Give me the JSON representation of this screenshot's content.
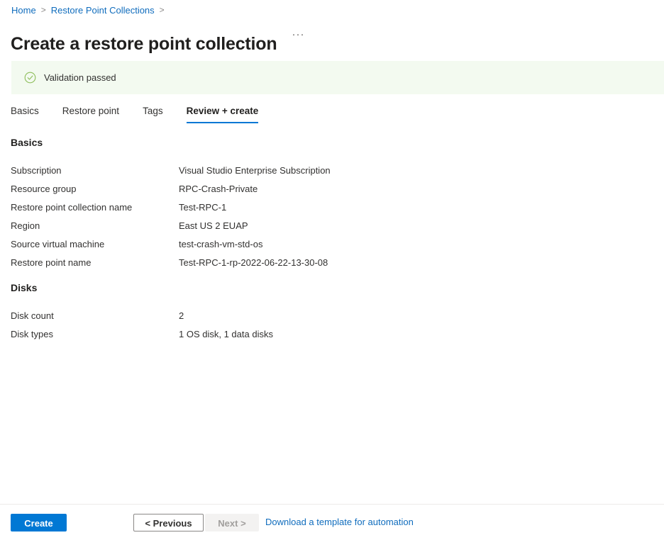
{
  "breadcrumb": {
    "items": [
      {
        "label": "Home"
      },
      {
        "label": "Restore Point Collections"
      }
    ],
    "separator": ">"
  },
  "header": {
    "title": "Create a restore point collection",
    "more_actions": "···"
  },
  "validation": {
    "message": "Validation passed",
    "icon": "check-circle-icon",
    "background_color": "#f3faf0",
    "icon_color": "#8cbd59"
  },
  "tabs": [
    {
      "label": "Basics",
      "active": false
    },
    {
      "label": "Restore point",
      "active": false
    },
    {
      "label": "Tags",
      "active": false
    },
    {
      "label": "Review + create",
      "active": true
    }
  ],
  "sections": [
    {
      "heading": "Basics",
      "rows": [
        {
          "label": "Subscription",
          "value": "Visual Studio Enterprise Subscription"
        },
        {
          "label": "Resource group",
          "value": "RPC-Crash-Private"
        },
        {
          "label": "Restore point collection name",
          "value": "Test-RPC-1"
        },
        {
          "label": "Region",
          "value": "East US 2 EUAP"
        },
        {
          "label": "Source virtual machine",
          "value": "test-crash-vm-std-os"
        },
        {
          "label": "Restore point name",
          "value": "Test-RPC-1-rp-2022-06-22-13-30-08"
        }
      ]
    },
    {
      "heading": "Disks",
      "rows": [
        {
          "label": "Disk count",
          "value": "2"
        },
        {
          "label": "Disk types",
          "value": "1 OS disk, 1 data disks"
        }
      ]
    }
  ],
  "footer": {
    "create_label": "Create",
    "previous_label": "< Previous",
    "next_label": "Next >",
    "download_template_label": "Download a template for automation",
    "accent_color": "#0078d4",
    "link_color": "#0f6cbd"
  }
}
